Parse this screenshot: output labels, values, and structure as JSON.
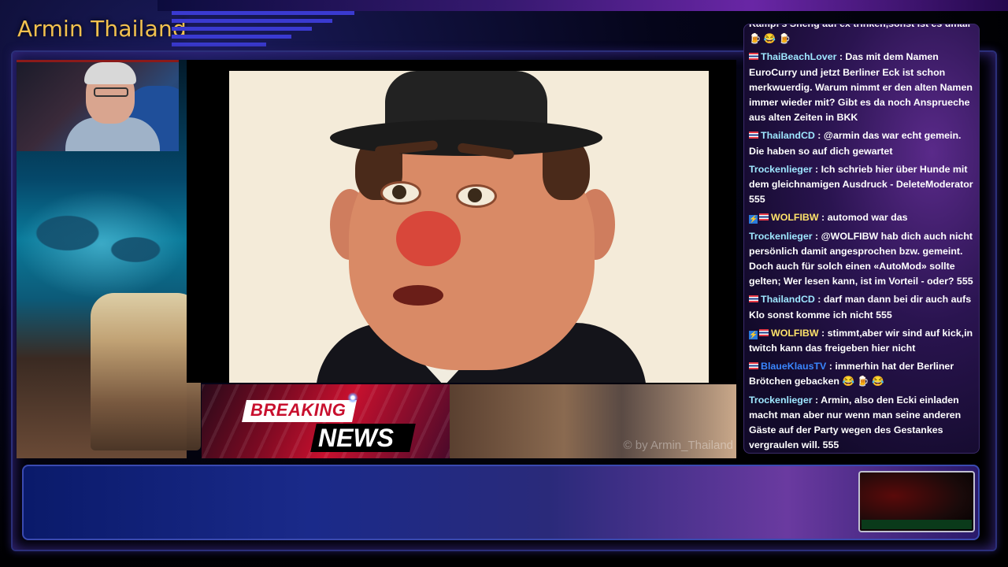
{
  "channel": {
    "title": "Armin Thailand"
  },
  "breaking_news": {
    "line1": "BREAKING",
    "line2": "NEWS"
  },
  "video": {
    "watermark": "© by Armin_Thailand"
  },
  "chat": {
    "messages": [
      {
        "user": "",
        "badge": "none",
        "text": "Kampf's Sheng auf ex trinken,sonst ist es umall",
        "emoji": "🍺 😂 🍺"
      },
      {
        "user": "ThaiBeachLover",
        "badge": "flag",
        "text": "Das mit dem Namen EuroCurry und jetzt Berliner Eck ist schon merkwuerdig. Warum nimmt er den alten Namen immer wieder mit? Gibt es da noch Ansprueche aus alten Zeiten in BKK",
        "emoji": ""
      },
      {
        "user": "ThailandCD",
        "badge": "flag",
        "text": "@armin das war echt gemein. Die haben so auf dich gewartet",
        "emoji": ""
      },
      {
        "user": "Trockenlieger",
        "badge": "none",
        "text": "Ich schrieb hier über Hunde mit dem gleichnamigen Ausdruck - DeleteModerator 555",
        "emoji": ""
      },
      {
        "user": "WOLFIBW",
        "badge": "both",
        "text": "automod war das",
        "emoji": ""
      },
      {
        "user": "Trockenlieger",
        "badge": "none",
        "text": "@WOLFIBW hab dich auch nicht persönlich damit angesprochen bzw. gemeint. Doch auch für solch einen «AutoMod» sollte gelten; Wer lesen kann, ist im Vorteil - oder? 555",
        "emoji": ""
      },
      {
        "user": "ThailandCD",
        "badge": "flag",
        "text": "darf man dann bei dir auch aufs Klo sonst komme ich nicht 555",
        "emoji": ""
      },
      {
        "user": "WOLFIBW",
        "badge": "both",
        "text": "stimmt,aber wir sind auf kick,in twitch kann das freigeben hier nicht",
        "emoji": ""
      },
      {
        "user": "BlaueKlausTV",
        "badge": "flag",
        "text": "immerhin hat der Berliner Brötchen gebacken",
        "emoji": "😂 🍺 😂"
      },
      {
        "user": "Trockenlieger",
        "badge": "none",
        "text": "Armin, also den Ecki einladen macht man aber nur wenn man seine anderen Gäste auf der Party wegen des Gestankes vergraulen will. 555",
        "emoji": ""
      }
    ]
  },
  "colors": {
    "title": "#f2c14e",
    "accent_blue": "#3a3ad0",
    "breaking_red": "#c8102e"
  }
}
